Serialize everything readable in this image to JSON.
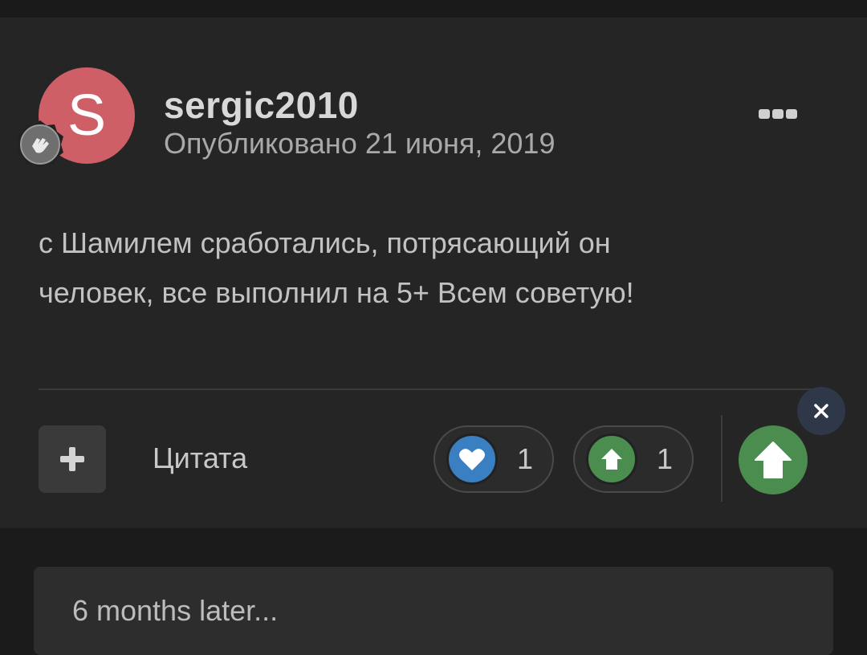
{
  "post": {
    "avatar_letter": "S",
    "username": "sergic2010",
    "posted": "Опубликовано 21 июня, 2019",
    "content_line1": "с Шамилем сработались, потрясающий он",
    "content_line2": "человек, все выполнил на 5+ Всем советую!"
  },
  "actions": {
    "quote_label": "Цитата",
    "reactions": [
      {
        "icon": "heart-icon",
        "count": "1",
        "color": "#3a7fc1"
      },
      {
        "icon": "up-arrow-icon",
        "count": "1",
        "color": "#4a8d4e"
      }
    ]
  },
  "later": {
    "text": "6 months later..."
  },
  "colors": {
    "avatar": "#cf5f67",
    "like": "#3a7fc1",
    "upvote": "#4a8d4e",
    "close": "#2f3849"
  }
}
